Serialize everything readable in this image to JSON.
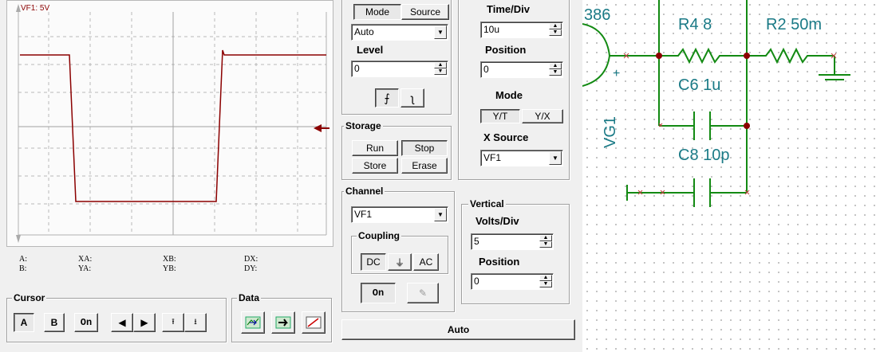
{
  "screen": {
    "channel_label": "VF1: 5V"
  },
  "readouts": {
    "a": "A:",
    "b": "B:",
    "xa": "XA:",
    "ya": "YA:",
    "xb": "XB:",
    "yb": "YB:",
    "dx": "DX:",
    "dy": "DY:"
  },
  "cursor": {
    "title": "Cursor",
    "a": "A",
    "b": "B",
    "on": "On"
  },
  "data": {
    "title": "Data"
  },
  "trigger": {
    "mode_tab": "Mode",
    "source_tab": "Source",
    "mode_value": "Auto",
    "level_label": "Level",
    "level_value": "0"
  },
  "timebase": {
    "time_div_label": "Time/Div",
    "time_div_value": "10u",
    "position_label": "Position",
    "position_value": "0",
    "mode_label": "Mode",
    "yt": "Y/T",
    "yx": "Y/X",
    "x_source_label": "X Source",
    "x_source_value": "VF1"
  },
  "storage": {
    "title": "Storage",
    "run": "Run",
    "stop": "Stop",
    "store": "Store",
    "erase": "Erase"
  },
  "channel": {
    "title": "Channel",
    "value": "VF1",
    "coupling_title": "Coupling",
    "dc": "DC",
    "ac": "AC",
    "on": "On"
  },
  "vertical": {
    "title": "Vertical",
    "volts_div_label": "Volts/Div",
    "volts_div_value": "5",
    "position_label": "Position",
    "position_value": "0"
  },
  "auto_button": "Auto",
  "schematic": {
    "r4": "R4 8",
    "r2": "R2 50m",
    "c6": "C6 1u",
    "c8": "C8 10p",
    "ic_fragment": "386",
    "vg1": "VG1",
    "plus": "+"
  },
  "colors": {
    "trace": "#8b0000",
    "schematic_wire": "#138a13",
    "schematic_text": "#1a7a86"
  }
}
